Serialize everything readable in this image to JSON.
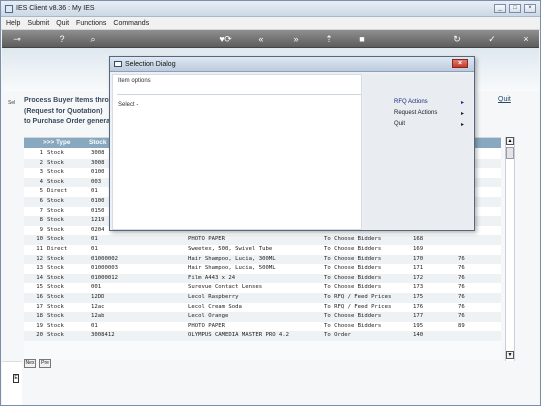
{
  "window": {
    "title": "IES Client v8.36 : My IES",
    "buttons": [
      "_",
      "□",
      "×"
    ]
  },
  "menu": {
    "items": [
      "Help",
      "Submit",
      "Quit",
      "Functions",
      "Commands"
    ]
  },
  "toolbar": {
    "icons": [
      {
        "name": "key-icon",
        "glyph": "⊸"
      },
      {
        "name": "help-icon",
        "glyph": "?"
      },
      {
        "name": "search-icon",
        "glyph": "⌕"
      },
      {
        "name": "favorite-icon",
        "glyph": "♥"
      },
      {
        "name": "refresh-icon",
        "glyph": "⟳"
      },
      {
        "name": "first-page-icon",
        "glyph": "«"
      },
      {
        "name": "next-page-icon",
        "glyph": "»"
      },
      {
        "name": "up-icon",
        "glyph": "⇡"
      },
      {
        "name": "stop-icon",
        "glyph": "■"
      },
      {
        "name": "sync-icon",
        "glyph": "↻"
      },
      {
        "name": "confirm-icon",
        "glyph": "✓"
      },
      {
        "name": "close-icon",
        "glyph": "×"
      }
    ]
  },
  "page": {
    "heading_lines": [
      "Process Buyer Items throu",
      "(Request for Quotation)",
      "to Purchase Order genera"
    ],
    "quit_label": "Quit"
  },
  "grid": {
    "columns": [
      ">>> Type",
      "Stock"
    ],
    "rows": [
      [
        "1",
        "Stock",
        "3008",
        "",
        "",
        "",
        ""
      ],
      [
        "2",
        "Stock",
        "3008",
        "",
        "",
        "",
        ""
      ],
      [
        "3",
        "Stock",
        "0100",
        "",
        "",
        "",
        ""
      ],
      [
        "4",
        "Stock",
        "003",
        "",
        "",
        "",
        ""
      ],
      [
        "5",
        "Direct",
        "01",
        "",
        "",
        "",
        ""
      ],
      [
        "6",
        "Stock",
        "0100",
        "",
        "",
        "",
        ""
      ],
      [
        "7",
        "Stock",
        "0150",
        "",
        "",
        "",
        ""
      ],
      [
        "8",
        "Stock",
        "1219",
        "",
        "",
        "",
        ""
      ],
      [
        "9",
        "Stock",
        "0204",
        "",
        "",
        "",
        ""
      ],
      [
        "10",
        "Stock",
        "01",
        "PHOTO PAPER",
        "To Choose Bidders",
        "168",
        ""
      ],
      [
        "11",
        "Direct",
        "01",
        "Sweetex, 500, Swivel Tube",
        "To Choose Bidders",
        "169",
        ""
      ],
      [
        "12",
        "Stock",
        "01000002",
        "Hair Shampoo, Lucia, 300ML",
        "To Choose Bidders",
        "170",
        "76"
      ],
      [
        "13",
        "Stock",
        "01000003",
        "Hair Shampoo, Lucia, 500ML",
        "To Choose Bidders",
        "171",
        "76"
      ],
      [
        "14",
        "Stock",
        "01000012",
        "Film A443 x 24",
        "To Choose Bidders",
        "172",
        "76"
      ],
      [
        "15",
        "Stock",
        "001",
        "Surevue Contact Lenses",
        "To Choose Bidders",
        "173",
        "76"
      ],
      [
        "16",
        "Stock",
        "12DD",
        "Lecol Raspberry",
        "To RFQ / Feed Prices",
        "175",
        "76"
      ],
      [
        "17",
        "Stock",
        "12ac",
        "Lecol Cream Soda",
        "To RFQ / Feed Prices",
        "176",
        "76"
      ],
      [
        "18",
        "Stock",
        "12ab",
        "Lecol Orange",
        "To Choose Bidders",
        "177",
        "76"
      ],
      [
        "19",
        "Stock",
        "01",
        "PHOTO PAPER",
        "To Choose Bidders",
        "195",
        "89"
      ],
      [
        "20",
        "Stock",
        "3008412",
        "OLYMPUS CAMEDIA MASTER PRO 4.2",
        "To Order",
        "140",
        ""
      ]
    ]
  },
  "nav": {
    "next_label": "Nex",
    "prev_label": "Pre",
    "strip_label": "Sel"
  },
  "dialog": {
    "title": "Selection Dialog",
    "item_options_label": "Item options",
    "select_label": "Select -",
    "close_glyph": "×",
    "actions": [
      {
        "label": "RFQ Actions",
        "active": true
      },
      {
        "label": "Request Actions",
        "active": false
      },
      {
        "label": "Quit",
        "active": false
      }
    ],
    "arrow_glyph": "▸"
  },
  "colors": {
    "grid_header": "#87a8bf",
    "dialog_close": "#c6392b",
    "active_action": "#1a287a"
  }
}
